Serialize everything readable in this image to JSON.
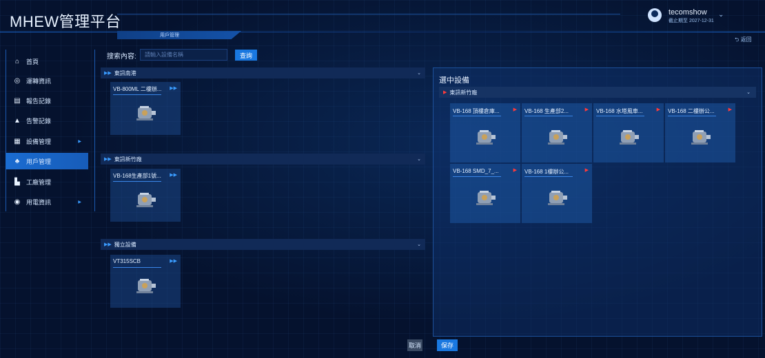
{
  "header": {
    "title": "MHEW管理平台",
    "breadcrumb": "用戶管理",
    "user_name": "tecomshow",
    "user_expiry": "截止期至 2027-12-31",
    "back_label": "返回"
  },
  "sidebar": {
    "items": [
      {
        "label": "首頁",
        "icon": "home-icon"
      },
      {
        "label": "運轉資訊",
        "icon": "target-icon"
      },
      {
        "label": "報告記錄",
        "icon": "report-icon"
      },
      {
        "label": "告警記錄",
        "icon": "bell-icon"
      },
      {
        "label": "設備管理",
        "icon": "grid-icon",
        "has_arrow": true
      },
      {
        "label": "用戶管理",
        "icon": "users-icon",
        "active": true
      },
      {
        "label": "工廠管理",
        "icon": "factory-icon"
      },
      {
        "label": "用電資訊",
        "icon": "power-icon",
        "has_arrow": true
      }
    ]
  },
  "search": {
    "label": "搜索內容:",
    "placeholder": "請輸入設備名稱",
    "button": "查詢"
  },
  "groups": [
    {
      "name": "東訊南港",
      "devices": [
        "VB-800ML 二樓辦..."
      ]
    },
    {
      "name": "東訊新竹廠",
      "devices": [
        "VB-168生產部1號..."
      ]
    },
    {
      "name": "獨立設備",
      "devices": [
        "VT315SCB"
      ]
    }
  ],
  "selected": {
    "title": "選中設備",
    "group": "東訊新竹廠",
    "devices": [
      "VB-168 頂樓倉庫...",
      "VB-168 生產部2...",
      "VB-168 水塔風車...",
      "VB-168 二樓辦公...",
      "VB-168 SMD_7_...",
      "VB-168 1樓辦公..."
    ]
  },
  "footer": {
    "cancel": "取消",
    "save": "保存"
  },
  "colors": {
    "background": "#05122e",
    "accent": "#1978e0",
    "remove_arrow": "#ff3b3b",
    "add_arrow": "#3a9cff"
  }
}
